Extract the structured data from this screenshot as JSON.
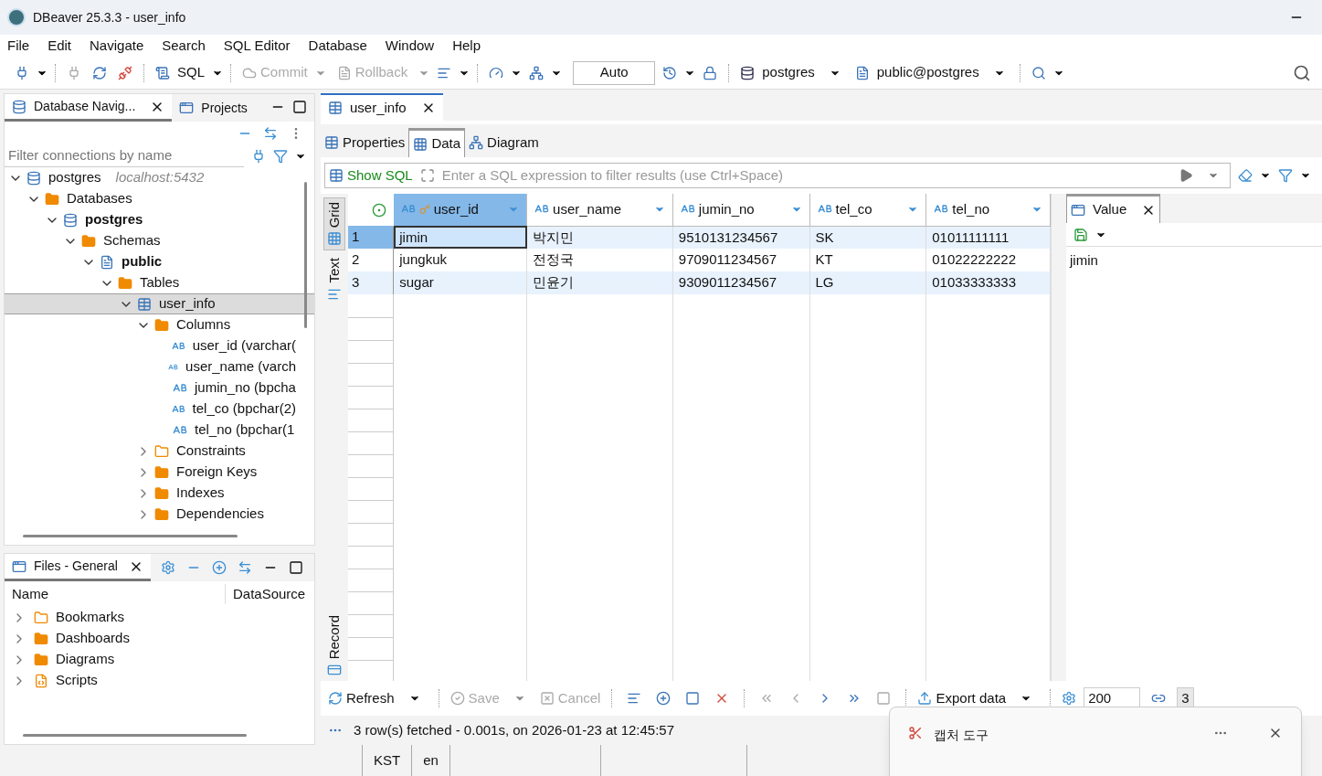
{
  "window": {
    "title": "DBeaver 25.3.3 - user_info"
  },
  "menu": [
    "File",
    "Edit",
    "Navigate",
    "Search",
    "SQL Editor",
    "Database",
    "Window",
    "Help"
  ],
  "toolbar": {
    "sql": "SQL",
    "commit": "Commit",
    "rollback": "Rollback",
    "mode": "Auto",
    "connection": "postgres",
    "schema": "public@postgres"
  },
  "navigator": {
    "tabs": [
      {
        "label": "Database Navig...",
        "selected": true
      },
      {
        "label": "Projects",
        "selected": false
      }
    ],
    "filter_placeholder": "Filter connections by name",
    "tree": [
      {
        "label": "postgres",
        "note": "localhost:5432",
        "kind": "connection",
        "expanded": true,
        "bold": false,
        "selected": false,
        "children": [
          {
            "label": "Databases",
            "kind": "folder",
            "expanded": true,
            "bold": false,
            "selected": false,
            "children": [
              {
                "label": "postgres",
                "kind": "database",
                "expanded": true,
                "bold": true,
                "selected": false,
                "children": [
                  {
                    "label": "Schemas",
                    "kind": "schemas",
                    "expanded": true,
                    "bold": false,
                    "selected": false,
                    "children": [
                      {
                        "label": "public",
                        "kind": "schema",
                        "expanded": true,
                        "bold": true,
                        "selected": false,
                        "children": [
                          {
                            "label": "Tables",
                            "kind": "tables",
                            "expanded": true,
                            "bold": false,
                            "selected": false,
                            "children": [
                              {
                                "label": "user_info",
                                "kind": "table",
                                "expanded": true,
                                "bold": false,
                                "selected": true,
                                "children": [
                                  {
                                    "label": "Columns",
                                    "kind": "folder",
                                    "expanded": true,
                                    "bold": false,
                                    "selected": false,
                                    "children": [
                                      {
                                        "label": "user_id (varchar(",
                                        "kind": "column",
                                        "bold": false,
                                        "selected": false
                                      },
                                      {
                                        "label": "user_name (varch",
                                        "kind": "column",
                                        "bold": false,
                                        "selected": false
                                      },
                                      {
                                        "label": "jumin_no (bpcha",
                                        "kind": "column",
                                        "bold": false,
                                        "selected": false
                                      },
                                      {
                                        "label": "tel_co (bpchar(2)",
                                        "kind": "column",
                                        "bold": false,
                                        "selected": false
                                      },
                                      {
                                        "label": "tel_no (bpchar(1",
                                        "kind": "column",
                                        "bold": false,
                                        "selected": false
                                      }
                                    ]
                                  },
                                  {
                                    "label": "Constraints",
                                    "kind": "constraints",
                                    "expanded": false,
                                    "bold": false,
                                    "selected": false
                                  },
                                  {
                                    "label": "Foreign Keys",
                                    "kind": "plainfolder",
                                    "expanded": false,
                                    "bold": false,
                                    "selected": false
                                  },
                                  {
                                    "label": "Indexes",
                                    "kind": "plainfolder",
                                    "expanded": false,
                                    "bold": false,
                                    "selected": false
                                  },
                                  {
                                    "label": "Dependencies",
                                    "kind": "plainfolder",
                                    "expanded": false,
                                    "bold": false,
                                    "selected": false
                                  }
                                ]
                              }
                            ]
                          }
                        ]
                      }
                    ]
                  }
                ]
              }
            ]
          }
        ]
      }
    ]
  },
  "files": {
    "tab": "Files - General",
    "columns": [
      "Name",
      "DataSource"
    ],
    "items": [
      {
        "label": "Bookmarks",
        "kind": "bookmarks",
        "expanded": false
      },
      {
        "label": "Dashboards",
        "kind": "dashboards",
        "expanded": false
      },
      {
        "label": "Diagrams",
        "kind": "dashboards",
        "expanded": false
      },
      {
        "label": "Scripts",
        "kind": "scripts",
        "expanded": false
      }
    ]
  },
  "editor": {
    "tab": "user_info",
    "subtabs": [
      {
        "label": "Properties",
        "selected": false
      },
      {
        "label": "Data",
        "selected": true
      },
      {
        "label": "Diagram",
        "selected": false
      }
    ],
    "show_sql": "Show SQL",
    "filter_placeholder": "Enter a SQL expression to filter results (use Ctrl+Space)",
    "side_tabs": [
      {
        "label": "Grid",
        "selected": true
      },
      {
        "label": "Text",
        "selected": false
      },
      {
        "label": "Record",
        "selected": false
      }
    ],
    "columns": [
      {
        "name": "user_id",
        "key": true,
        "selected": true
      },
      {
        "name": "user_name",
        "key": false,
        "selected": false
      },
      {
        "name": "jumin_no",
        "key": false,
        "selected": false
      },
      {
        "name": "tel_co",
        "key": false,
        "selected": false
      },
      {
        "name": "tel_no",
        "key": false,
        "selected": false
      }
    ],
    "rows": [
      {
        "num": "1",
        "selected": true,
        "cells": [
          "jimin",
          "박지민",
          "9510131234567",
          "SK",
          "01011111111"
        ]
      },
      {
        "num": "2",
        "selected": false,
        "cells": [
          "jungkuk",
          "전정국",
          "9709011234567",
          "KT",
          "01022222222"
        ]
      },
      {
        "num": "3",
        "selected": false,
        "cells": [
          "sugar",
          "민윤기",
          "9309011234567",
          "LG",
          "01033333333"
        ]
      }
    ],
    "value_panel": {
      "tab": "Value",
      "value": "jimin"
    },
    "bottom": {
      "refresh": "Refresh",
      "save": "Save",
      "cancel": "Cancel",
      "export": "Export data",
      "fetch_size": "200",
      "count": "3",
      "save_disabled": true,
      "cancel_disabled": true
    },
    "status": "3 row(s) fetched - 0.001s, on 2026-01-23 at 12:45:57"
  },
  "status_bar": [
    "KST",
    "en"
  ],
  "toast": {
    "title": "캡처 도구"
  }
}
